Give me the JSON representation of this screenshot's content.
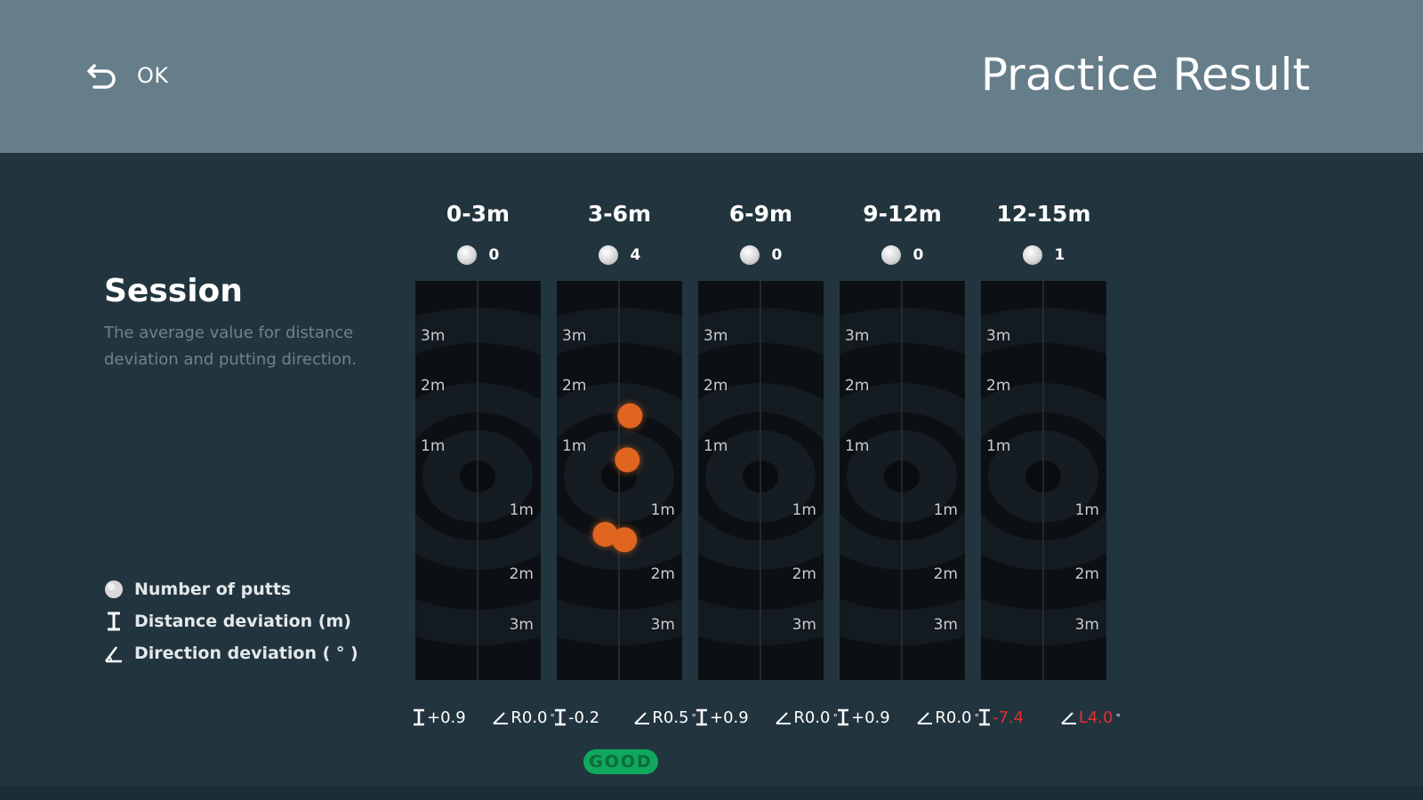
{
  "header": {
    "back_label": "OK",
    "title": "Practice Result"
  },
  "session": {
    "title": "Session",
    "description": "The average value for distance deviation and putting direction."
  },
  "legend": {
    "putts": "Number of putts",
    "distance": "Distance deviation (m)",
    "direction": "Direction deviation ( ° )"
  },
  "distance_labels": {
    "top": [
      "3m",
      "2m",
      "1m"
    ],
    "bottom": [
      "1m",
      "2m",
      "3m"
    ]
  },
  "ranges": [
    {
      "label": "0-3m",
      "putts": "0",
      "distance": "+0.9",
      "direction": "R0.0",
      "red": false,
      "good": false,
      "putts_marks": []
    },
    {
      "label": "3-6m",
      "putts": "4",
      "distance": "-0.2",
      "direction": "R0.5",
      "red": false,
      "good": true,
      "putts_marks": [
        {
          "lateral_m": 0.2,
          "depth_m": 1.1
        },
        {
          "lateral_m": 0.15,
          "depth_m": 0.3
        },
        {
          "lateral_m": -0.25,
          "depth_m": -1.05
        },
        {
          "lateral_m": 0.1,
          "depth_m": -1.15
        }
      ]
    },
    {
      "label": "6-9m",
      "putts": "0",
      "distance": "+0.9",
      "direction": "R0.0",
      "red": false,
      "good": false,
      "putts_marks": []
    },
    {
      "label": "9-12m",
      "putts": "0",
      "distance": "+0.9",
      "direction": "R0.0",
      "red": false,
      "good": false,
      "putts_marks": []
    },
    {
      "label": "12-15m",
      "putts": "1",
      "distance": "-7.4",
      "direction": "L4.0",
      "red": true,
      "good": false,
      "putts_marks": []
    }
  ],
  "badge": "GOOD",
  "colors": {
    "header_bg": "#667d8a",
    "body_bg": "#22353e",
    "ball": "#e0651f",
    "good": "#0fa85d",
    "bad": "#e03030"
  },
  "icons": [
    "back-arrow-icon",
    "golf-ball-icon",
    "distance-deviation-icon",
    "direction-deviation-icon"
  ]
}
